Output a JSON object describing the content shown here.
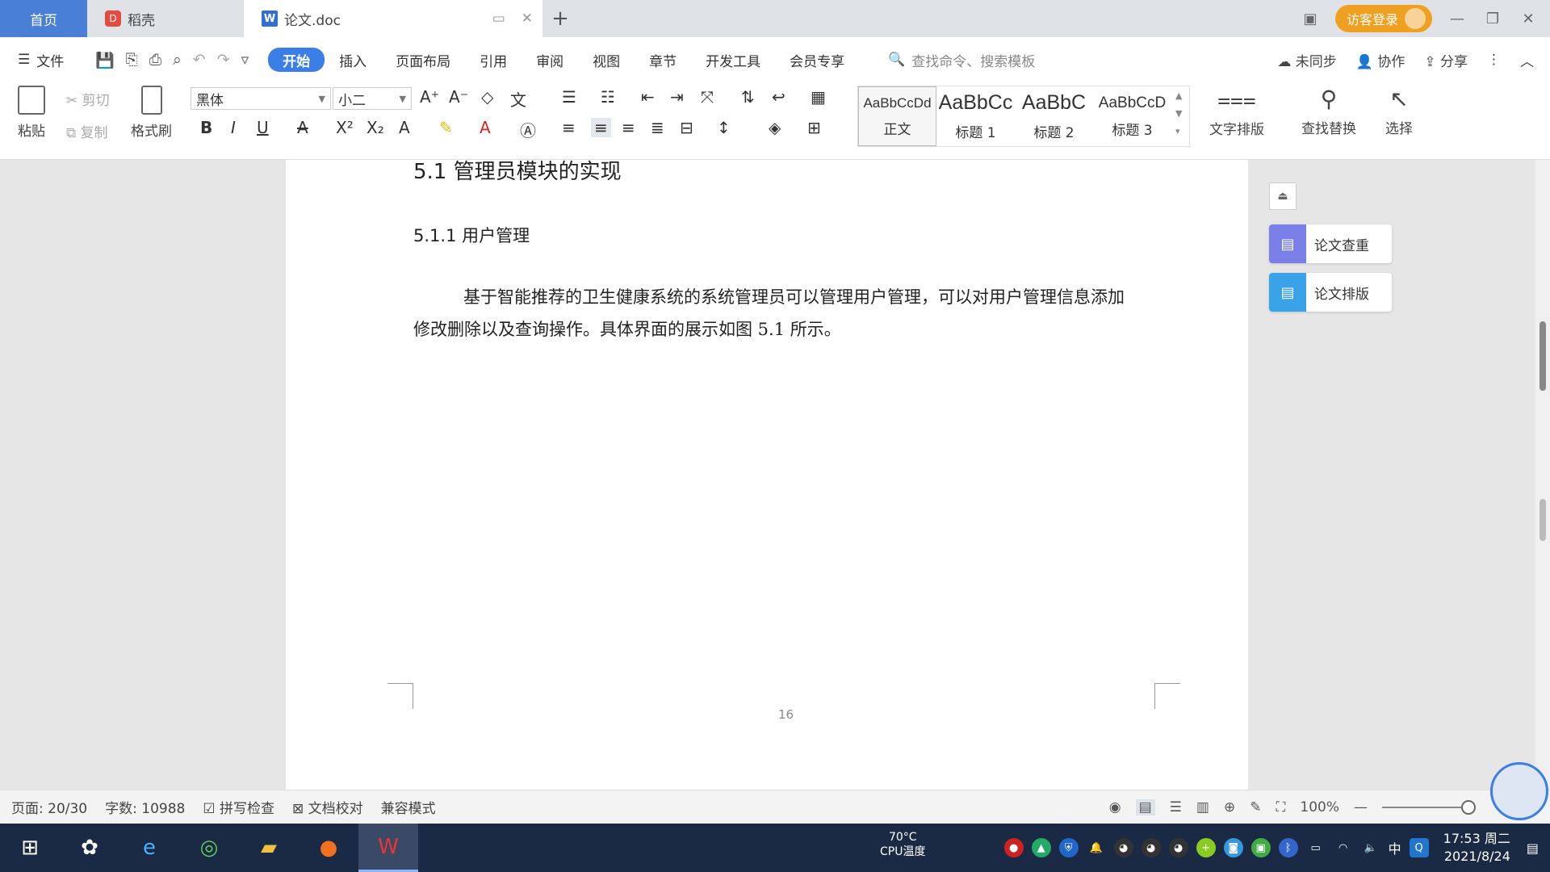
{
  "tabs": {
    "home": "首页",
    "shell": "稻壳",
    "doc": "论文.doc",
    "new_tab": "+"
  },
  "titlebar": {
    "login": "访客登录"
  },
  "menu": {
    "file": "文件",
    "tabs": [
      "开始",
      "插入",
      "页面布局",
      "引用",
      "审阅",
      "视图",
      "章节",
      "开发工具",
      "会员专享"
    ],
    "search_placeholder": "查找命令、搜索模板",
    "sync": "未同步",
    "collab": "协作",
    "share": "分享"
  },
  "ribbon": {
    "paste": "粘贴",
    "cut": "剪切",
    "copy": "复制",
    "format_painter": "格式刷",
    "font_name": "黑体",
    "font_size": "小二",
    "styles": [
      {
        "sample": "AaBbCcDd",
        "label": "正文"
      },
      {
        "sample": "AaBbCc",
        "label": "标题 1"
      },
      {
        "sample": "AaBbC",
        "label": "标题 2"
      },
      {
        "sample": "AaBbCcD",
        "label": "标题 3"
      }
    ],
    "text_layout": "文字排版",
    "find_replace": "查找替换",
    "select": "选择"
  },
  "document": {
    "heading2": "5.1  管理员模块的实现",
    "heading3": "5.1.1  用户管理",
    "paragraph": "基于智能推荐的卫生健康系统的系统管理员可以管理用户管理，可以对用户管理信息添加修改删除以及查询操作。具体界面的展示如图 5.1 所示。",
    "page_number": "16"
  },
  "side": {
    "plagiarism": "论文查重",
    "typeset": "论文排版"
  },
  "status": {
    "page": "页面: 20/30",
    "words": "字数: 10988",
    "spell": "拼写检查",
    "proof": "文档校对",
    "compat": "兼容模式",
    "zoom": "100%"
  },
  "taskbar": {
    "cpu_temp": "70°C",
    "cpu_label": "CPU温度",
    "ime": "中",
    "time": "17:53 周二",
    "date": "2021/8/24"
  },
  "colors": {
    "accent": "#3b7ee8",
    "home_tab": "#4a7fd6",
    "login": "#f0a020"
  }
}
